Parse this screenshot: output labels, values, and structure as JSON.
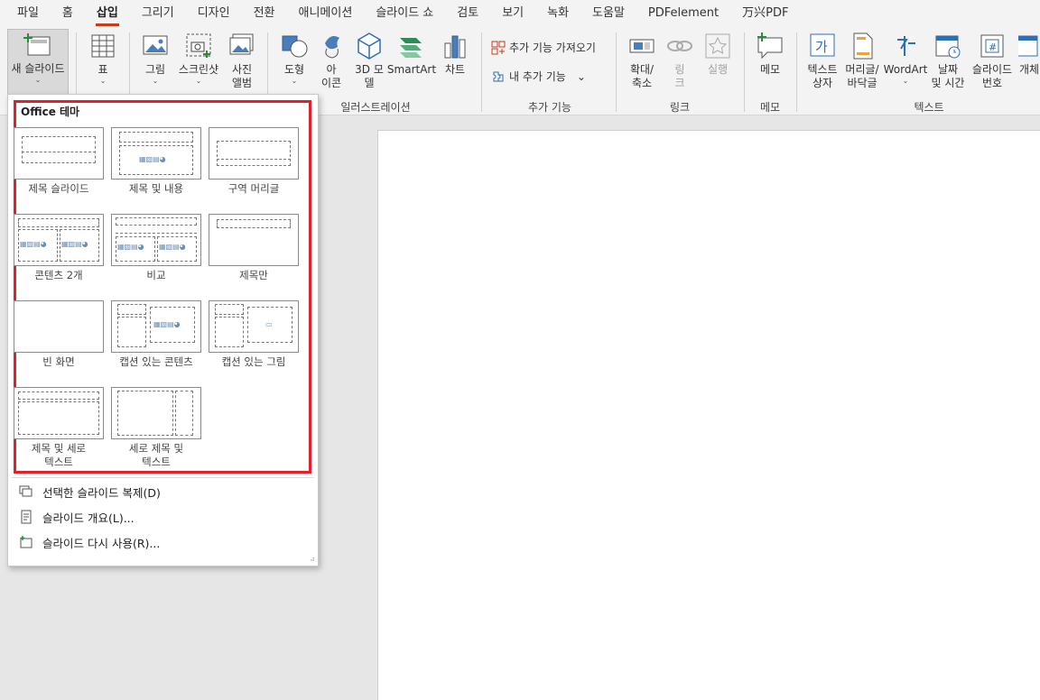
{
  "menu_tabs": [
    "파일",
    "홈",
    "삽입",
    "그리기",
    "디자인",
    "전환",
    "애니메이션",
    "슬라이드 쇼",
    "검토",
    "보기",
    "녹화",
    "도움말",
    "PDFelement",
    "万兴PDF"
  ],
  "active_tab": "삽입",
  "ribbon": {
    "new_slide": "새 슬라이드",
    "table": "표",
    "image": "그림",
    "screenshot": "스크린샷",
    "photo_album_1": "사진",
    "photo_album_2": "앨범",
    "shapes": "도형",
    "icons_1": "아",
    "icons_2": "이콘",
    "model3d_1": "3D 모",
    "model3d_2": "델",
    "smartart": "SmartArt",
    "chart": "차트",
    "get_addins": "추가 기능 가져오기",
    "my_addins": "내 추가 기능",
    "zoom_1": "확대/",
    "zoom_2": "축소",
    "link": "링",
    "link_2": "크",
    "action": "실행",
    "comment": "메모",
    "textbox_1": "텍스트",
    "textbox_2": "상자",
    "header_1": "머리글/",
    "header_2": "바닥글",
    "wordart": "WordArt",
    "datetime_1": "날짜",
    "datetime_2": "및 시간",
    "slidenum_1": "슬라이드",
    "slidenum_2": "번호",
    "object": "개체",
    "group_illustrations": "일러스트레이션",
    "group_addins": "추가 기능",
    "group_links": "링크",
    "group_comments": "메모",
    "group_text": "텍스트"
  },
  "dropdown": {
    "header": "Office 테마",
    "layouts": [
      {
        "label": "제목 슬라이드"
      },
      {
        "label": "제목 및 내용"
      },
      {
        "label": "구역 머리글"
      },
      {
        "label": "콘텐츠 2개"
      },
      {
        "label": "비교"
      },
      {
        "label": "제목만"
      },
      {
        "label": "빈 화면"
      },
      {
        "label": "캡션 있는 콘텐츠"
      },
      {
        "label": "캡션 있는 그림"
      },
      {
        "label": "제목 및 세로 텍스트"
      },
      {
        "label": "세로 제목 및 텍스트"
      }
    ],
    "menu": [
      {
        "label": "선택한 슬라이드 복제(D)"
      },
      {
        "label": "슬라이드 개요(L)..."
      },
      {
        "label": "슬라이드 다시 사용(R)..."
      }
    ]
  },
  "colors": {
    "accent": "#c43e1c",
    "highlight": "#e0202a"
  }
}
